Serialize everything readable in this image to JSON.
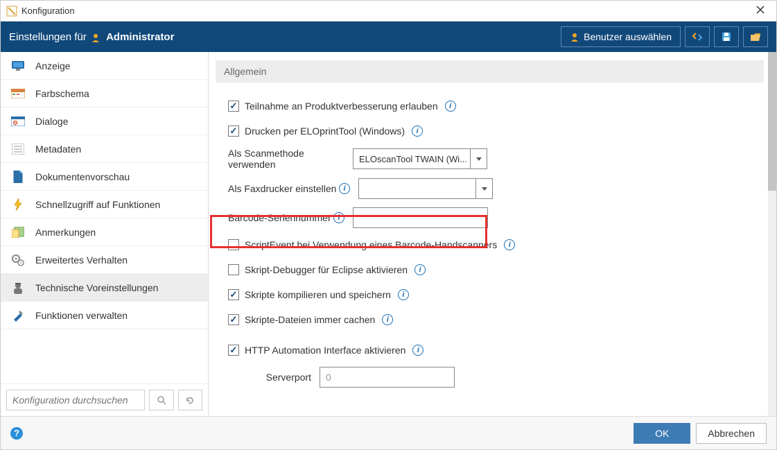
{
  "window": {
    "title": "Konfiguration"
  },
  "header": {
    "settings_for": "Einstellungen für",
    "username": "Administrator",
    "select_user": "Benutzer auswählen"
  },
  "sidebar": {
    "items": [
      {
        "label": "Anzeige"
      },
      {
        "label": "Farbschema"
      },
      {
        "label": "Dialoge"
      },
      {
        "label": "Metadaten"
      },
      {
        "label": "Dokumentenvorschau"
      },
      {
        "label": "Schnellzugriff auf Funktionen"
      },
      {
        "label": "Anmerkungen"
      },
      {
        "label": "Erweitertes Verhalten"
      },
      {
        "label": "Technische Voreinstellungen"
      },
      {
        "label": "Funktionen verwalten"
      }
    ],
    "search_placeholder": "Konfiguration durchsuchen"
  },
  "content": {
    "section_title": "Allgemein",
    "opt_product_improvement": "Teilnahme an Produktverbesserung erlauben",
    "opt_print_tool": "Drucken per ELOprintTool (Windows)",
    "lbl_scan_method": "Als Scanmethode verwenden",
    "val_scan_method": "ELOscanTool TWAIN (Wi...",
    "lbl_fax_printer": "Als Faxdrucker einstellen",
    "val_fax_printer": "",
    "lbl_barcode_serial": "Barcode-Seriennummer",
    "val_barcode_serial": "",
    "opt_script_event": "ScriptEvent bei Verwendung eines Barcode-Handscanners",
    "opt_debugger": "Skript-Debugger für Eclipse aktivieren",
    "opt_compile": "Skripte kompilieren und speichern",
    "opt_cache": "Skripte-Dateien immer cachen",
    "opt_http": "HTTP Automation Interface aktivieren",
    "lbl_serverport": "Serverport",
    "val_serverport": "0"
  },
  "footer": {
    "ok": "OK",
    "cancel": "Abbrechen"
  }
}
